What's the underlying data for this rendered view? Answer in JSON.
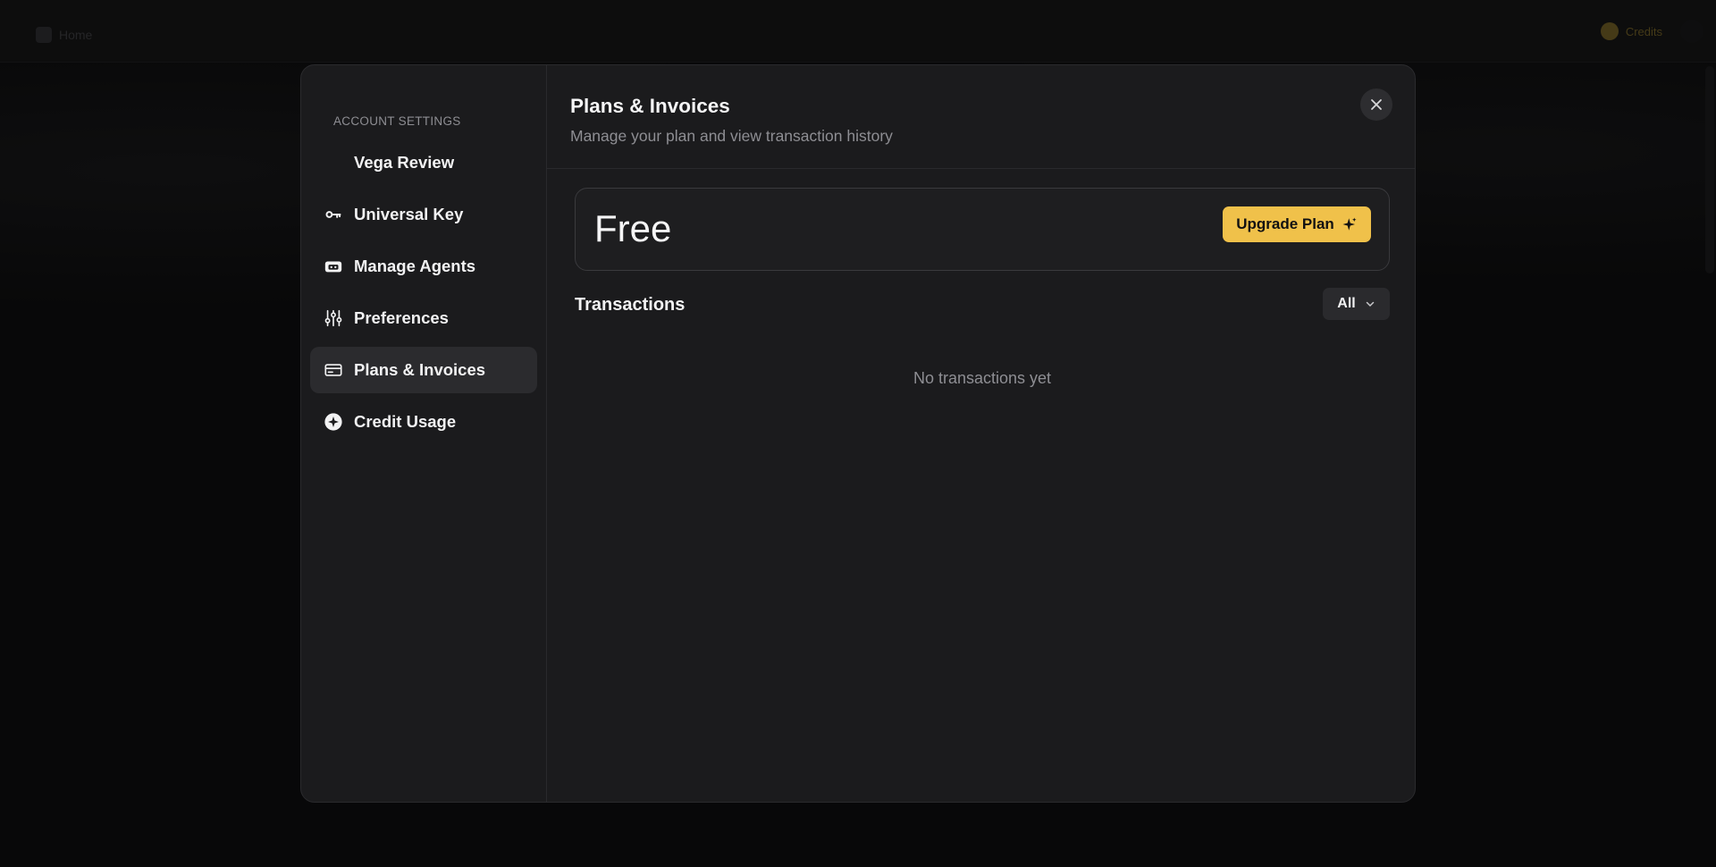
{
  "background": {
    "home_label": "Home",
    "credits_label": "Credits"
  },
  "sidebar": {
    "heading": "ACCOUNT SETTINGS",
    "items": [
      {
        "label": "Vega Review",
        "icon": "blank-icon"
      },
      {
        "label": "Universal Key",
        "icon": "key-icon"
      },
      {
        "label": "Manage Agents",
        "icon": "robot-icon"
      },
      {
        "label": "Preferences",
        "icon": "sliders-icon"
      },
      {
        "label": "Plans & Invoices",
        "icon": "credit-card-icon",
        "active": true
      },
      {
        "label": "Credit Usage",
        "icon": "credit-coin-icon"
      }
    ]
  },
  "main": {
    "title": "Plans & Invoices",
    "subtitle": "Manage your plan and view transaction history",
    "plan": {
      "name": "Free",
      "upgrade_label": "Upgrade Plan"
    },
    "transactions": {
      "title": "Transactions",
      "filter_value": "All",
      "empty_text": "No transactions yet"
    }
  },
  "colors": {
    "accent": "#f0c14a",
    "modal_bg": "#1b1b1d",
    "active_item_bg": "#2b2b2e",
    "muted_text": "#8e8e93"
  }
}
